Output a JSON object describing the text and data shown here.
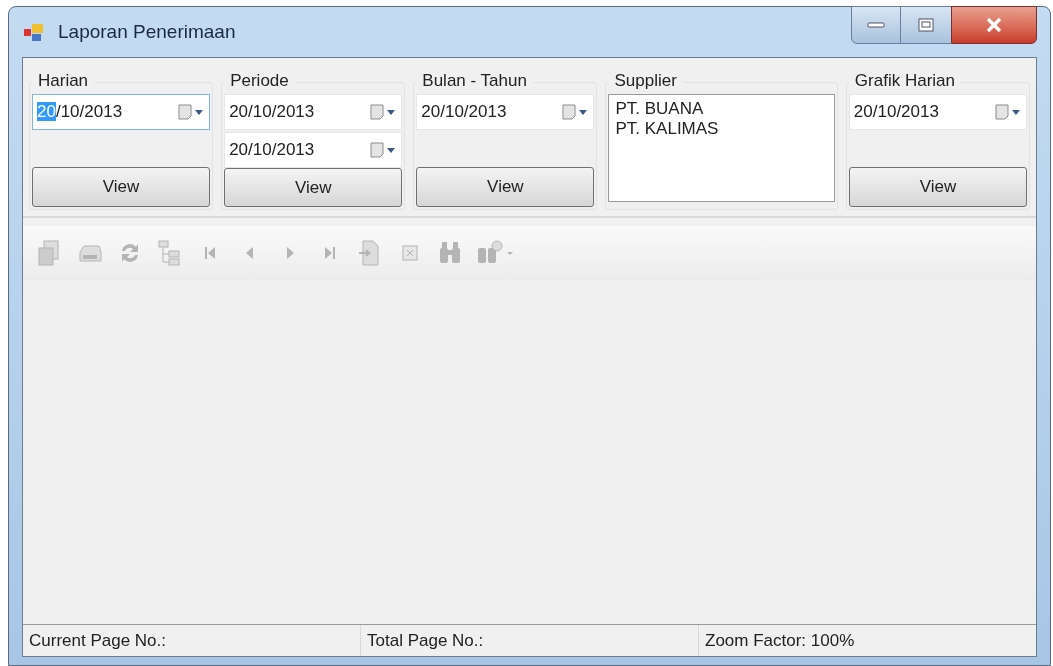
{
  "window": {
    "title": "Laporan Penerimaan"
  },
  "groups": [
    {
      "kind": "dates",
      "label": "Harian",
      "dates": [
        {
          "value": "20/10/2013",
          "focused": true
        }
      ],
      "button": "View"
    },
    {
      "kind": "dates",
      "label": "Periode",
      "dates": [
        {
          "value": "20/10/2013",
          "focused": false
        },
        {
          "value": "20/10/2013",
          "focused": false
        }
      ],
      "button": "View"
    },
    {
      "kind": "dates",
      "label": "Bulan - Tahun",
      "dates": [
        {
          "value": "20/10/2013",
          "focused": false
        }
      ],
      "button": "View"
    },
    {
      "kind": "list",
      "label": "Supplier",
      "items": [
        "PT. BUANA",
        "PT. KALIMAS"
      ]
    },
    {
      "kind": "dates",
      "label": "Grafik Harian",
      "dates": [
        {
          "value": "20/10/2013",
          "focused": false
        }
      ],
      "button": "View"
    }
  ],
  "toolbar": [
    {
      "kind": "export",
      "disabled": true
    },
    {
      "kind": "print",
      "disabled": true
    },
    {
      "kind": "refresh",
      "disabled": true
    },
    {
      "kind": "tree",
      "disabled": true
    },
    {
      "kind": "first",
      "disabled": true
    },
    {
      "kind": "prev",
      "disabled": true
    },
    {
      "kind": "next",
      "disabled": true
    },
    {
      "kind": "last",
      "disabled": true
    },
    {
      "kind": "goto",
      "disabled": true
    },
    {
      "kind": "stop",
      "disabled": true
    },
    {
      "kind": "find",
      "disabled": true
    },
    {
      "kind": "zoom",
      "disabled": true
    }
  ],
  "status_bar": [
    "Current Page No.:",
    "Total Page No.:",
    "Zoom Factor: 100%"
  ]
}
